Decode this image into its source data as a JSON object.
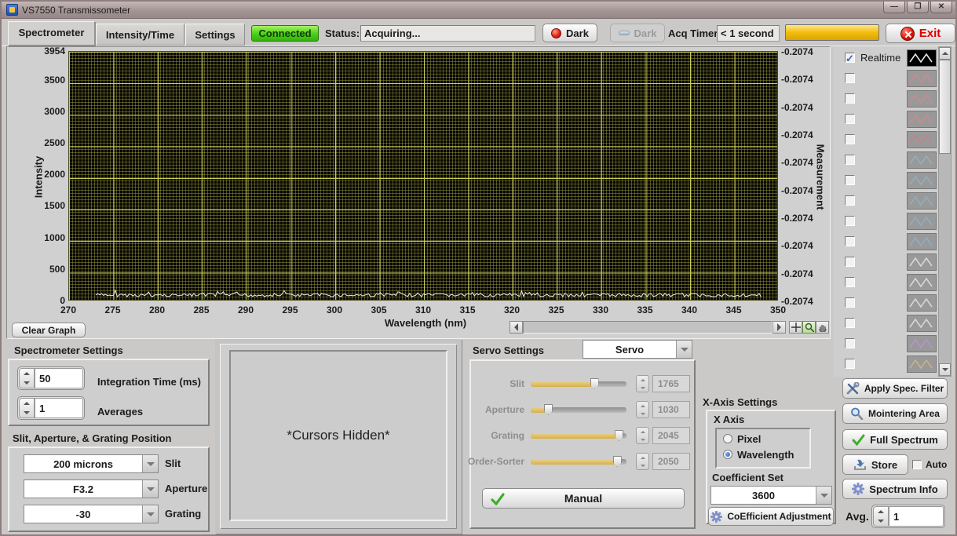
{
  "window": {
    "title": "VS7550 Transmissometer"
  },
  "tabs": [
    {
      "label": "Spectrometer",
      "active": true
    },
    {
      "label": "Intensity/Time",
      "active": false
    },
    {
      "label": "Settings",
      "active": false
    }
  ],
  "topbar": {
    "connected_label": "Connected",
    "status_label": "Status:",
    "status_value": "Acquiring...",
    "dark_button_label": "Dark",
    "dark_button_disabled_label": "Dark",
    "acq_timer_label": "Acq Timer",
    "acq_timer_value": "< 1 second",
    "exit_label": "Exit"
  },
  "chart_data": {
    "type": "line",
    "xlabel": "Wavelength (nm)",
    "ylabel": "Intensity",
    "y2label": "Measurement",
    "xlim": [
      270,
      350
    ],
    "ylim": [
      0,
      3954
    ],
    "xticks": [
      270,
      275,
      280,
      285,
      290,
      295,
      300,
      305,
      310,
      315,
      320,
      325,
      330,
      335,
      340,
      345,
      350
    ],
    "yticks": [
      3954,
      3500,
      3000,
      2500,
      2000,
      1500,
      1000,
      500,
      0
    ],
    "y2ticks": [
      "-0.2074",
      "-0.2074",
      "-0.2074",
      "-0.2074",
      "-0.2074",
      "-0.2074",
      "-0.2074",
      "-0.2074",
      "-0.2074",
      "-0.2074"
    ],
    "grid": "dense yellow minor+major grid on black",
    "series": [
      {
        "name": "Realtime",
        "color": "#ffffff",
        "shape": "flat noisy baseline",
        "approx_intensity": 100,
        "x_start": 273,
        "x_end": 348
      }
    ],
    "legend_position": "right"
  },
  "graph_controls": {
    "clear_button": "Clear Graph",
    "tools": [
      "cursor-tool",
      "zoom-tool",
      "pan-tool"
    ]
  },
  "legend": {
    "rows": [
      {
        "label": "Realtime",
        "checked": true,
        "color": "#ffffff",
        "bg": "#000000"
      },
      {
        "label": "",
        "checked": false,
        "color": "#cf8a8c",
        "bg": "#999999"
      },
      {
        "label": "",
        "checked": false,
        "color": "#cf8a8c",
        "bg": "#999999"
      },
      {
        "label": "",
        "checked": false,
        "color": "#cf8a8c",
        "bg": "#999999"
      },
      {
        "label": "",
        "checked": false,
        "color": "#c58184",
        "bg": "#999999"
      },
      {
        "label": "",
        "checked": false,
        "color": "#8fb0c8",
        "bg": "#999999"
      },
      {
        "label": "",
        "checked": false,
        "color": "#8fb0c8",
        "bg": "#999999"
      },
      {
        "label": "",
        "checked": false,
        "color": "#8fb0c8",
        "bg": "#999999"
      },
      {
        "label": "",
        "checked": false,
        "color": "#8fb0c8",
        "bg": "#999999"
      },
      {
        "label": "",
        "checked": false,
        "color": "#8fb0c8",
        "bg": "#999999"
      },
      {
        "label": "",
        "checked": false,
        "color": "#dedede",
        "bg": "#999999"
      },
      {
        "label": "",
        "checked": false,
        "color": "#dedede",
        "bg": "#999999"
      },
      {
        "label": "",
        "checked": false,
        "color": "#dedede",
        "bg": "#999999"
      },
      {
        "label": "",
        "checked": false,
        "color": "#dedede",
        "bg": "#999999"
      },
      {
        "label": "",
        "checked": false,
        "color": "#b894d4",
        "bg": "#999999"
      },
      {
        "label": "",
        "checked": false,
        "color": "#ccb687",
        "bg": "#999999"
      }
    ]
  },
  "spectrometer_settings": {
    "title": "Spectrometer Settings",
    "integration_time": {
      "value": "50",
      "label": "Integration Time (ms)"
    },
    "averages": {
      "value": "1",
      "label": "Averages"
    }
  },
  "position_settings": {
    "title": "Slit, Aperture, & Grating Position",
    "items": [
      {
        "value": "200 microns",
        "label": "Slit"
      },
      {
        "value": "F3.2",
        "label": "Aperture"
      },
      {
        "value": "-30",
        "label": "Grating"
      }
    ]
  },
  "cursors_panel": {
    "text": "*Cursors Hidden*"
  },
  "servo": {
    "title": "Servo Settings",
    "mode_value": "Servo",
    "sliders": [
      {
        "label": "Slit",
        "value": "1765",
        "fill_pct": 66
      },
      {
        "label": "Aperture",
        "value": "1030",
        "fill_pct": 18
      },
      {
        "label": "Grating",
        "value": "2045",
        "fill_pct": 92
      },
      {
        "label": "Order-Sorter",
        "value": "2050",
        "fill_pct": 90
      }
    ],
    "manual_button": "Manual"
  },
  "xaxis_settings": {
    "title": "X-Axis Settings",
    "group_label": "X Axis",
    "options": [
      {
        "label": "Pixel",
        "selected": false
      },
      {
        "label": "Wavelength",
        "selected": true
      }
    ],
    "coefficient_label": "Coefficient Set",
    "coefficient_value": "3600",
    "adjustment_button": "CoEfficient Adjustment"
  },
  "actions": {
    "apply_filter": "Apply Spec. Filter",
    "mointering": "Mointering Area",
    "full_spectrum": "Full Spectrum",
    "store": "Store",
    "auto_label": "Auto",
    "spectrum_info": "Spectrum Info",
    "avg_label": "Avg.",
    "avg_value": "1"
  },
  "colors": {
    "connected_green": "#49cf17",
    "progress_yellow": "#f3bc0e",
    "exit_red": "#d41408",
    "grid_yellow": "#d4d460",
    "slider_fill": "#d4b051"
  }
}
